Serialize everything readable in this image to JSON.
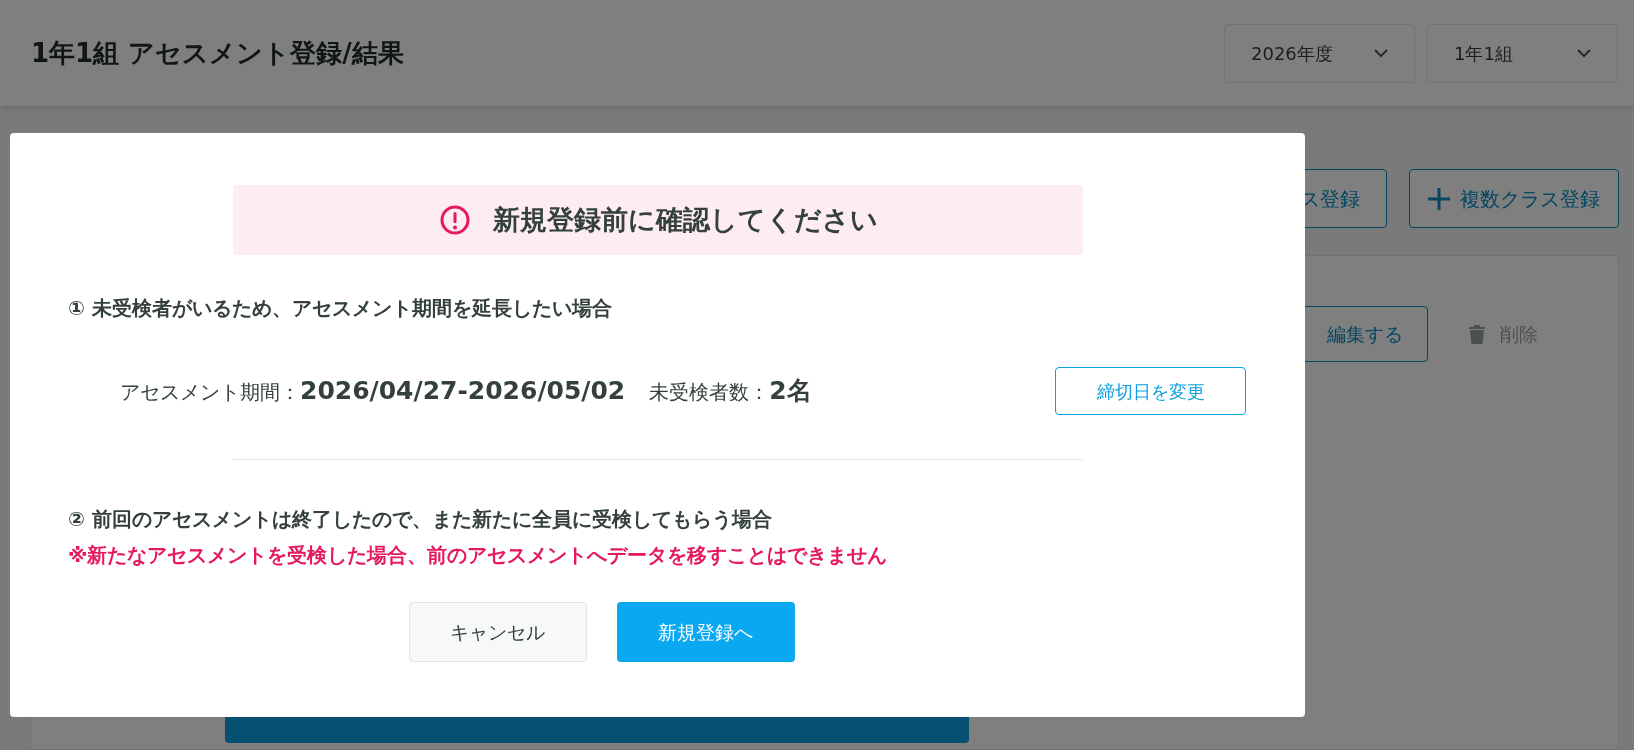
{
  "header": {
    "title": "1年1組 アセスメント登録/結果",
    "selects": [
      {
        "value": "2026年度"
      },
      {
        "value": "1年1組"
      }
    ]
  },
  "toolbar": {
    "buttons": [
      {
        "label": "ス登録",
        "kind": "plain"
      },
      {
        "label": "複数クラス登録",
        "kind": "add"
      }
    ]
  },
  "card": {
    "edit_button": "編集する",
    "delete_button": {
      "label": "削除",
      "disabled": true
    }
  },
  "modal": {
    "banner": "新規登録前に確認してください",
    "option_1": {
      "heading": "① 未受検者がいるため、アセスメント期間を延長したい場合",
      "period": "アセスメント期間：**2026/04/27-2026/05/02**",
      "count": "未受検者数：**2名**",
      "button": "締切日を変更"
    },
    "option_2": {
      "heading": "② 前回のアセスメントは終了したので、また新たに全員に受検してもらう場合",
      "warning": "※新たなアセスメントを受検した場合、前のアセスメントへデータを移すことはできません"
    },
    "buttons": [
      {
        "label": "キャンセル",
        "kind": "secondary"
      },
      {
        "label": "新規登録へ",
        "kind": "primary"
      }
    ]
  }
}
